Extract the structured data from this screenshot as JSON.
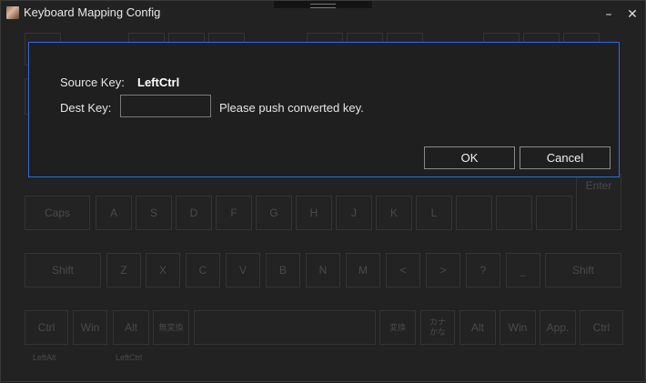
{
  "window": {
    "title": "Keyboard Mapping Config",
    "minimize_glyph": "–",
    "close_glyph": "✕",
    "app_icon": "app-icon"
  },
  "dialog": {
    "source_label": "Source Key:",
    "source_value": "LeftCtrl",
    "dest_label": "Dest Key:",
    "dest_value": "",
    "hint": "Please push converted key.",
    "ok_label": "OK",
    "cancel_label": "Cancel"
  },
  "keyboard": {
    "enter": "Enter",
    "caps": "Caps",
    "row_a": [
      "A",
      "S",
      "D",
      "F",
      "G",
      "H",
      "J",
      "K",
      "L"
    ],
    "shift_left": "Shift",
    "row_z": [
      "Z",
      "X",
      "C",
      "V",
      "B",
      "N",
      "M",
      "<",
      ">",
      "?",
      "_"
    ],
    "shift_right": "Shift",
    "ctrl_left": "Ctrl",
    "win_left": "Win",
    "alt_left": "Alt",
    "muhenkan": "無変換",
    "henkan": "変換",
    "kana": "カナ かな",
    "alt_right": "Alt",
    "win_right": "Win",
    "app": "App.",
    "ctrl_right": "Ctrl",
    "sub_leftalt": "LeftAlt",
    "sub_leftctrl": "LeftCtrl"
  }
}
